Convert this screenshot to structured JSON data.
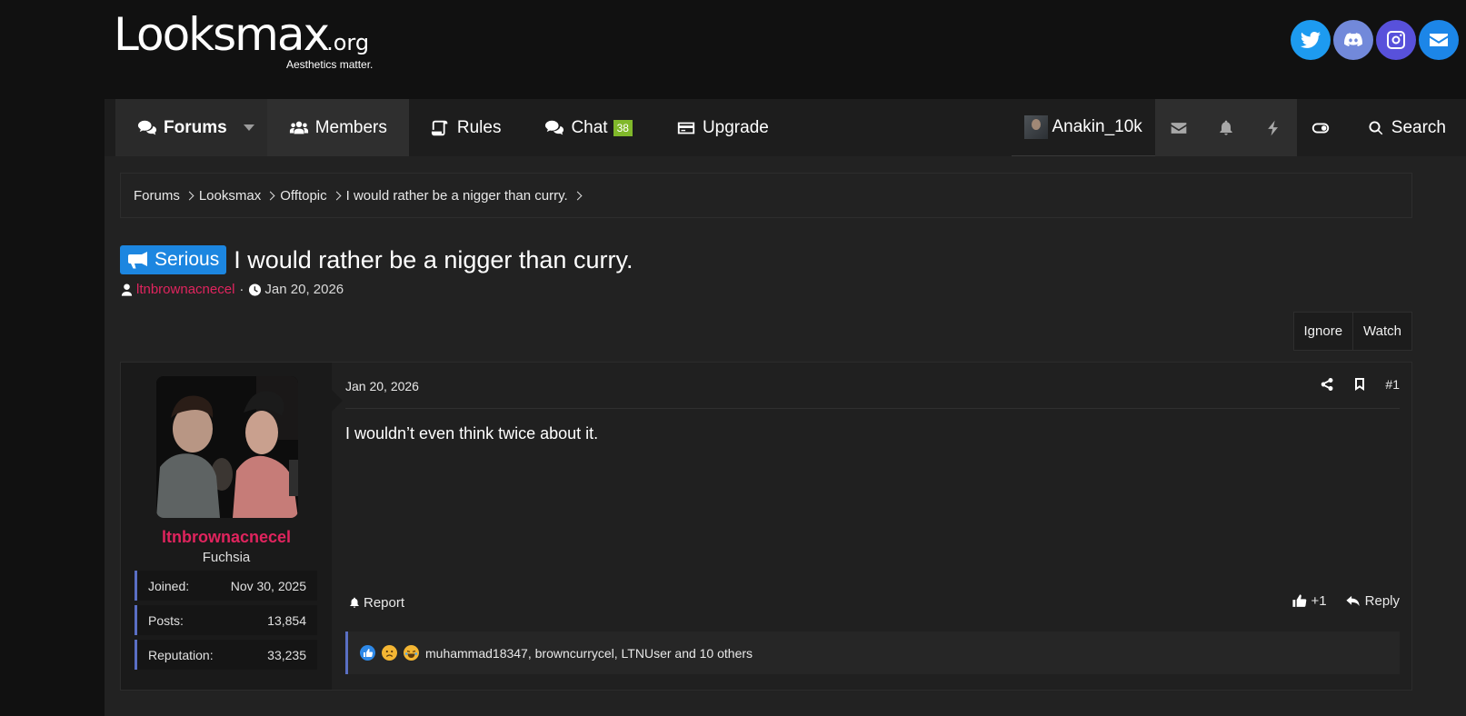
{
  "header": {
    "logo_text": "Looksmax",
    "logo_suffix": ".org",
    "tagline": "Aesthetics matter.",
    "socials": [
      {
        "name": "twitter-icon",
        "color": "#1d9bf0"
      },
      {
        "name": "discord-icon",
        "color": "#7289da"
      },
      {
        "name": "instagram-icon",
        "color": "#5851db"
      },
      {
        "name": "mail-icon",
        "color": "#1c86e8"
      }
    ]
  },
  "nav": {
    "forums": "Forums",
    "members": "Members",
    "rules": "Rules",
    "chat": "Chat",
    "chat_count": "38",
    "upgrade": "Upgrade",
    "username": "Anakin_10k",
    "search": "Search"
  },
  "breadcrumb": [
    "Forums",
    "Looksmax",
    "Offtopic",
    "I would rather be a nigger than curry."
  ],
  "thread": {
    "prefix": "Serious",
    "prefix_color": "#1c86e0",
    "title": "I would rather be a nigger than curry.",
    "author": "ltnbrownacnecel",
    "date": "Jan 20, 2026"
  },
  "thread_actions": {
    "ignore": "Ignore",
    "watch": "Watch"
  },
  "post": {
    "date": "Jan 20, 2026",
    "number": "#1",
    "body": "I wouldn’t even think twice about it.",
    "report": "Report",
    "like": "+1",
    "reply": "Reply",
    "reactions_text": "muhammad18347, browncurrycel, LTNUser and 10 others",
    "reaction_icons": [
      "like-reaction-icon",
      "sad-reaction-icon",
      "laugh-reaction-icon"
    ]
  },
  "poster": {
    "name": "ltnbrownacnecel",
    "title": "Fuchsia",
    "name_color": "#e0245e",
    "stats": [
      {
        "label": "Joined:",
        "value": "Nov 30, 2025"
      },
      {
        "label": "Posts:",
        "value": "13,854"
      },
      {
        "label": "Reputation:",
        "value": "33,235"
      }
    ]
  }
}
